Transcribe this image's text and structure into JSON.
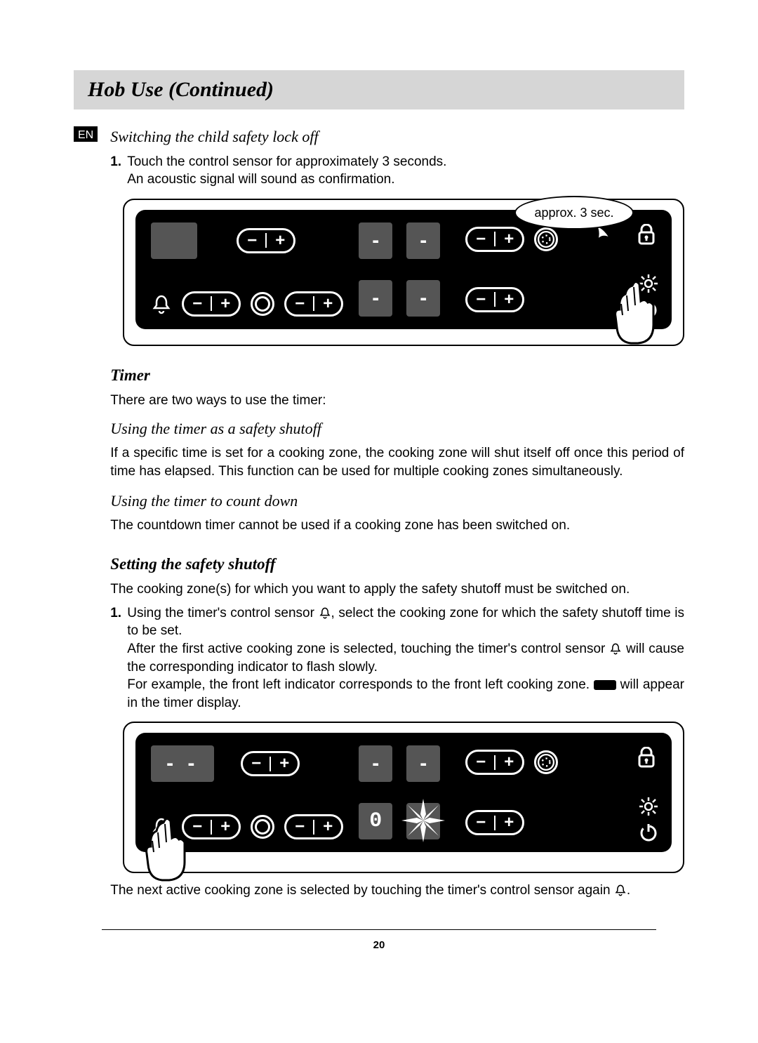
{
  "title": "Hob Use (Continued)",
  "lang_badge": "EN",
  "section1": {
    "heading": "Switching the child safety lock off",
    "step1_num": "1.",
    "step1_line1": "Touch the control sensor for approximately 3 seconds.",
    "step1_line2": "An acoustic signal will sound as confirmation.",
    "bubble": "approx. 3 sec."
  },
  "timer": {
    "heading": "Timer",
    "intro": "There are two ways to use the timer:",
    "sub1_heading": "Using the timer as a safety shutoff",
    "sub1_body": "If a specific time is set for a cooking zone, the cooking zone will shut itself off once this period of time has elapsed. This function can be used for multiple cooking zones simultaneously.",
    "sub2_heading": "Using the timer to count down",
    "sub2_body": "The countdown timer cannot be used if a cooking zone has been switched on."
  },
  "setting": {
    "heading": "Setting the safety shutoff",
    "intro": "The cooking zone(s) for which you want to apply the safety shutoff must be switched on.",
    "step1_num": "1.",
    "step1_a": "Using the timer's control sensor ",
    "step1_b": ", select the cooking zone for which the safety shutoff time is to be set.",
    "step1_c1": "After the first active cooking zone is selected, touching the timer's control sensor ",
    "step1_c2": " will cause the corresponding indicator to flash slowly.",
    "step1_d1": "For example, the front left indicator corresponds to the front left cooking zone. ",
    "step1_d2": " will appear in the timer display.",
    "after_fig1": "The next active cooking zone is selected by touching the timer's control sensor again ",
    "after_fig2": "."
  },
  "page_number": "20"
}
